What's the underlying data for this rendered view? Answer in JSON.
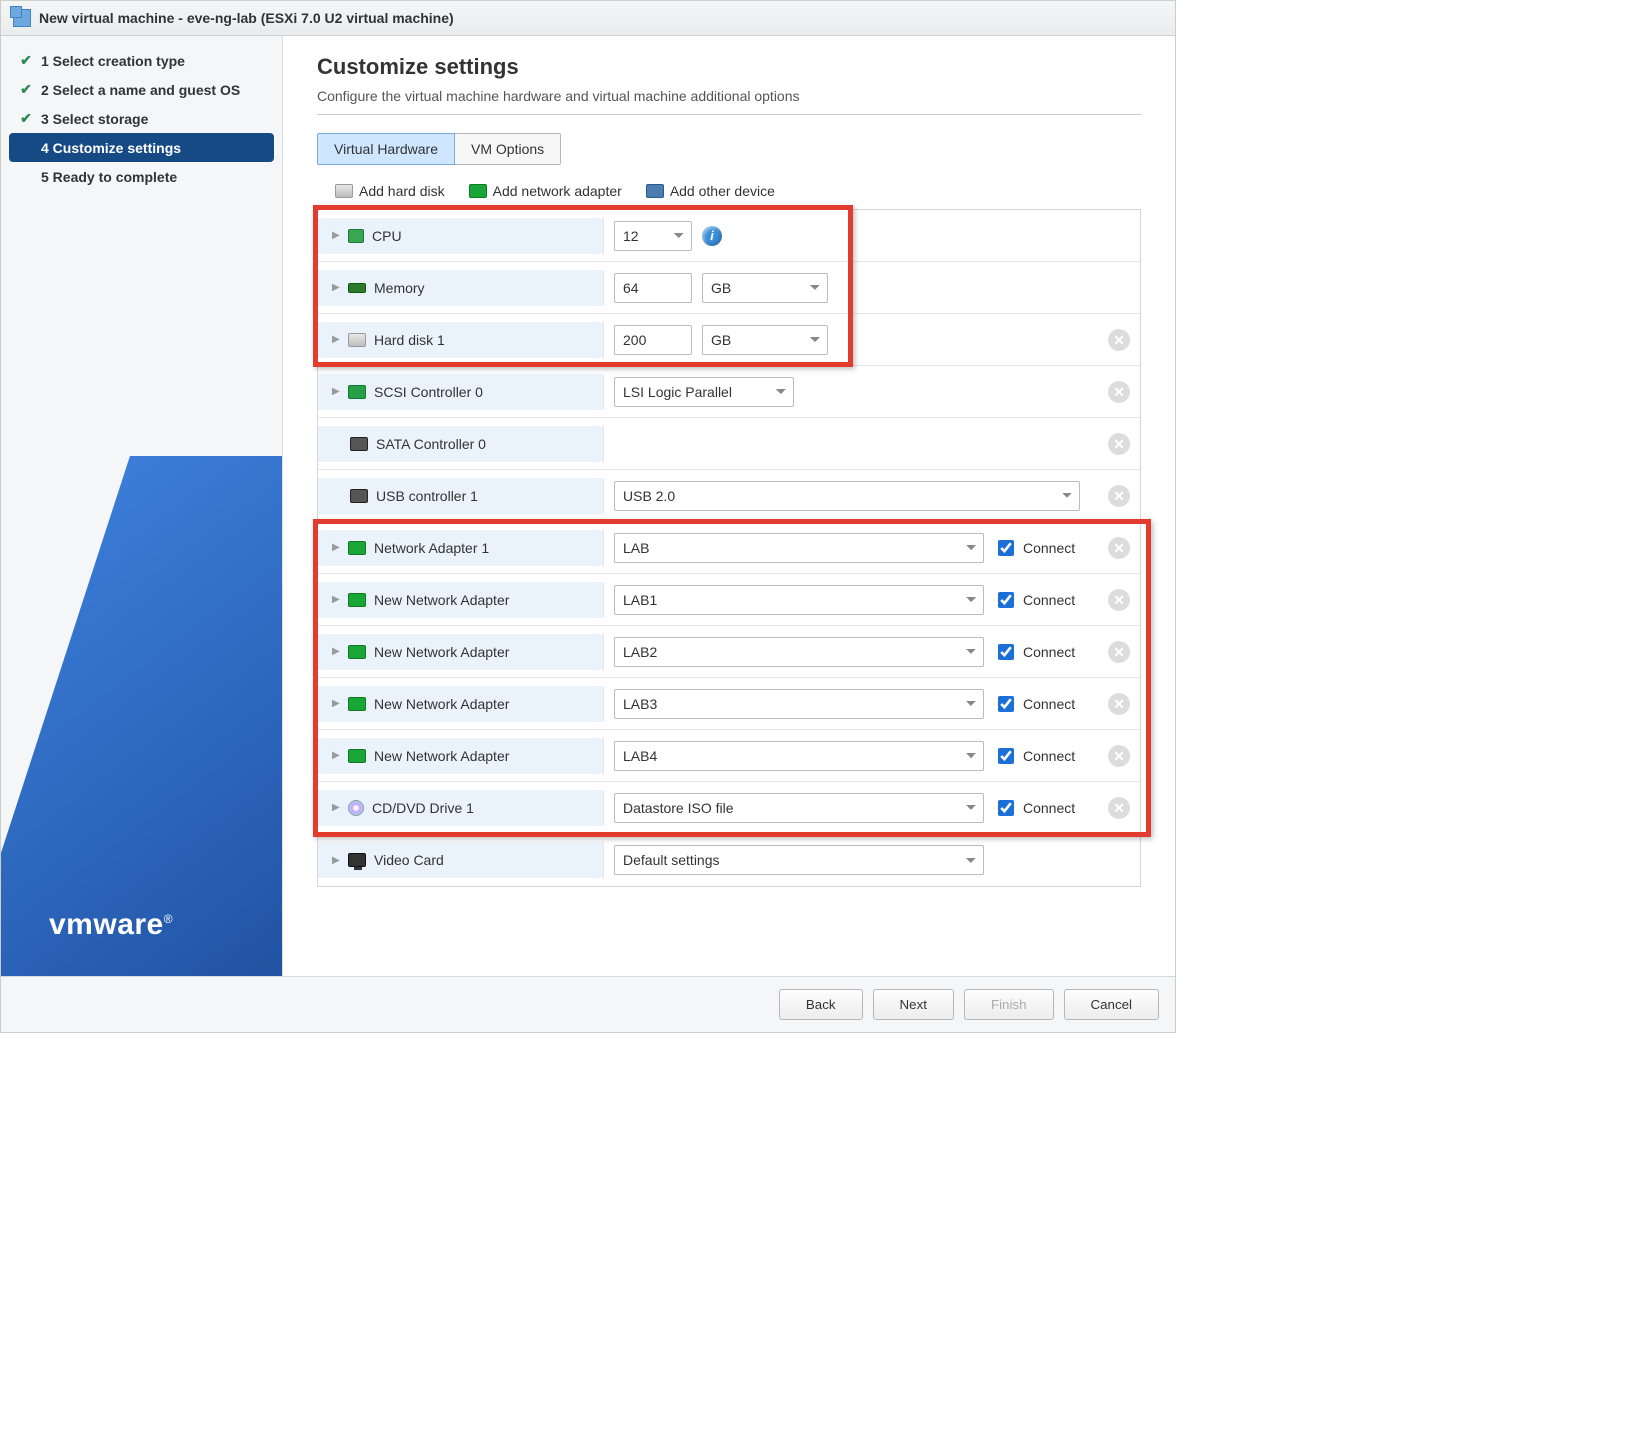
{
  "window": {
    "title": "New virtual machine - eve-ng-lab (ESXi 7.0 U2 virtual machine)"
  },
  "steps": [
    {
      "label": "1 Select creation type",
      "done": true
    },
    {
      "label": "2 Select a name and guest OS",
      "done": true
    },
    {
      "label": "3 Select storage",
      "done": true
    },
    {
      "label": "4 Customize settings",
      "active": true
    },
    {
      "label": "5 Ready to complete"
    }
  ],
  "page": {
    "title": "Customize settings",
    "subtitle": "Configure the virtual machine hardware and virtual machine additional options"
  },
  "tabs": {
    "hw": "Virtual Hardware",
    "opts": "VM Options"
  },
  "toolbar": {
    "addDisk": "Add hard disk",
    "addNic": "Add network adapter",
    "addOther": "Add other device"
  },
  "hw": {
    "cpu": {
      "label": "CPU",
      "value": "12"
    },
    "mem": {
      "label": "Memory",
      "value": "64",
      "unit": "GB"
    },
    "hd1": {
      "label": "Hard disk 1",
      "value": "200",
      "unit": "GB"
    },
    "scsi": {
      "label": "SCSI Controller 0",
      "value": "LSI Logic Parallel"
    },
    "sata": {
      "label": "SATA Controller 0"
    },
    "usb": {
      "label": "USB controller 1",
      "value": "USB 2.0"
    },
    "nic1": {
      "label": "Network Adapter 1",
      "value": "LAB",
      "connect": "Connect"
    },
    "nic2": {
      "label": "New Network Adapter",
      "value": "LAB1",
      "connect": "Connect"
    },
    "nic3": {
      "label": "New Network Adapter",
      "value": "LAB2",
      "connect": "Connect"
    },
    "nic4": {
      "label": "New Network Adapter",
      "value": "LAB3",
      "connect": "Connect"
    },
    "nic5": {
      "label": "New Network Adapter",
      "value": "LAB4",
      "connect": "Connect"
    },
    "cd": {
      "label": "CD/DVD Drive 1",
      "value": "Datastore ISO file",
      "connect": "Connect"
    },
    "video": {
      "label": "Video Card",
      "value": "Default settings"
    }
  },
  "footer": {
    "back": "Back",
    "next": "Next",
    "finish": "Finish",
    "cancel": "Cancel"
  },
  "brand": "vmware"
}
